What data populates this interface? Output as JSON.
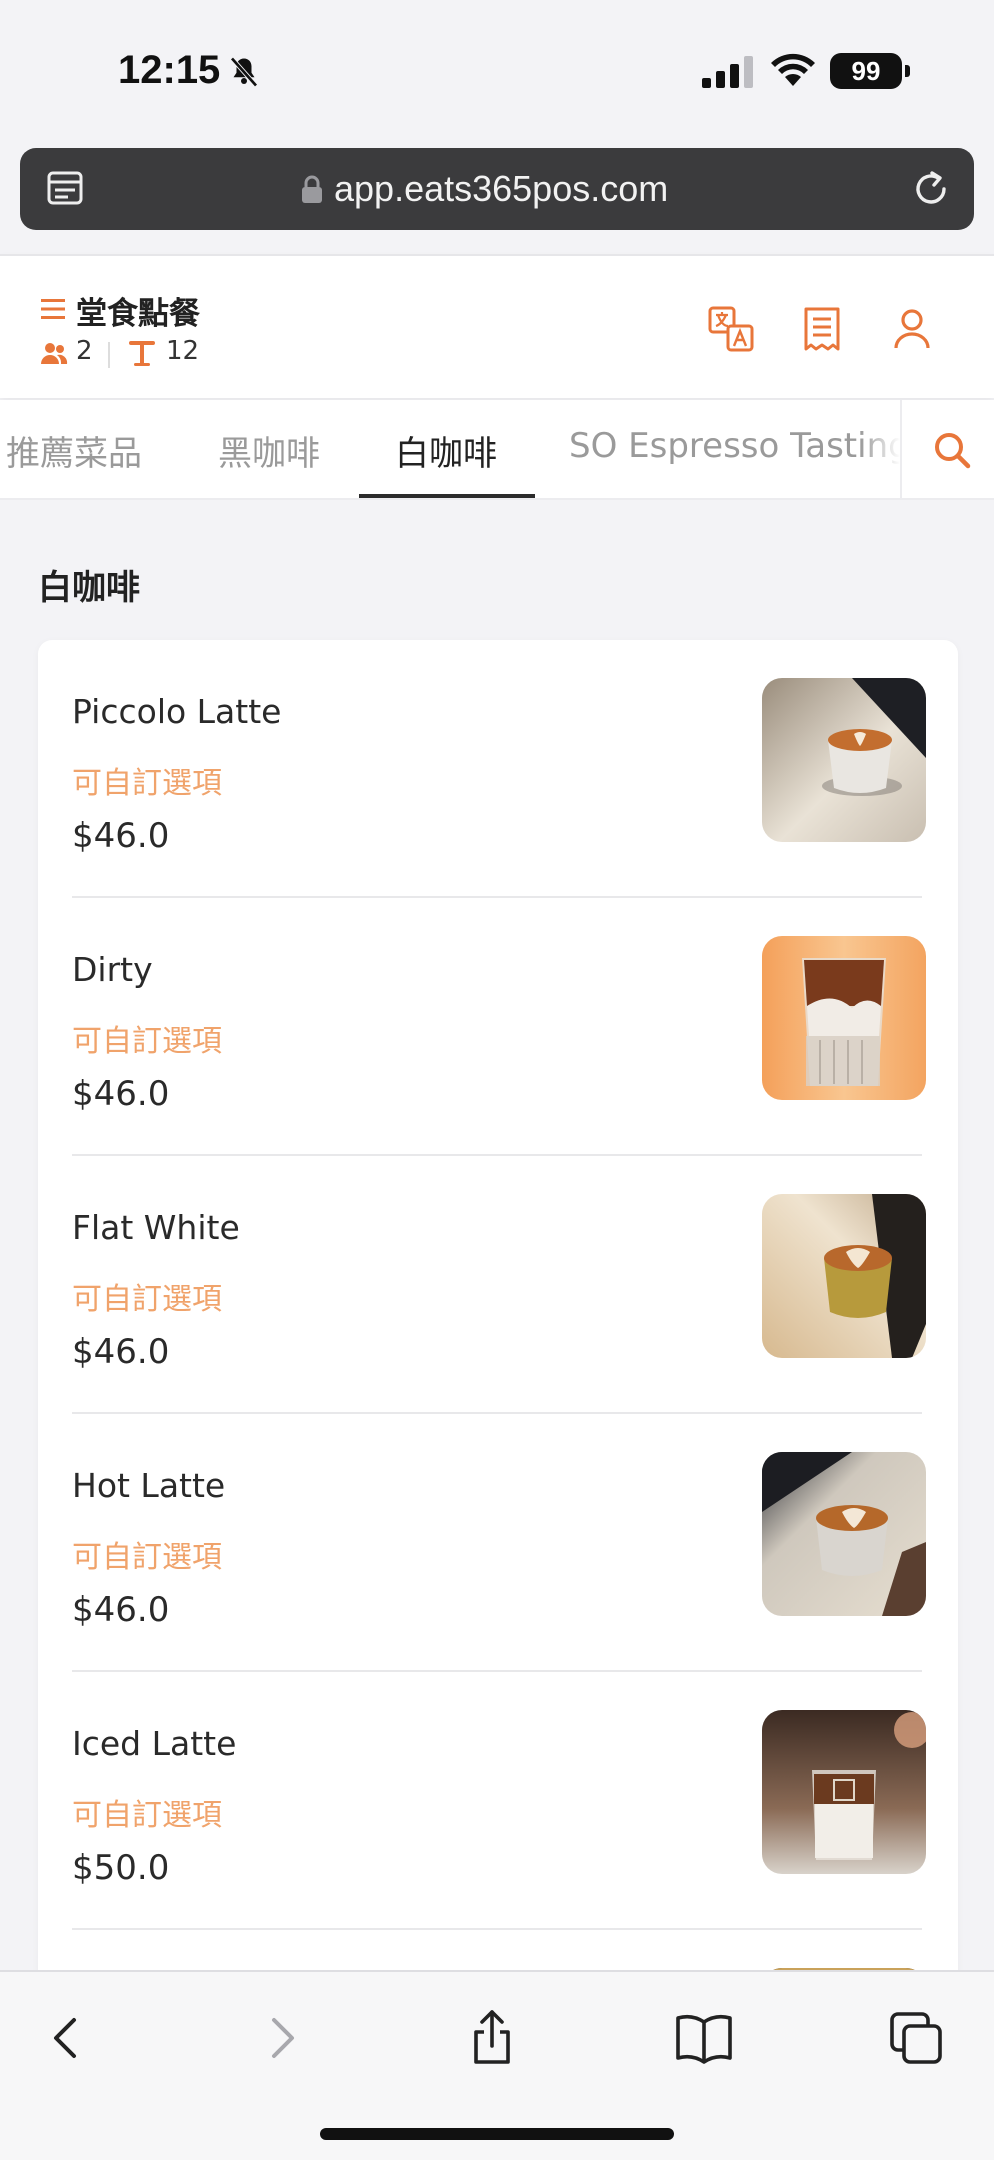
{
  "status_bar": {
    "time": "12:15",
    "battery": "99"
  },
  "browser": {
    "url": "app.eats365pos.com"
  },
  "header": {
    "title": "堂食點餐",
    "guests": "2",
    "table": "12"
  },
  "tabs": [
    {
      "label": "推薦菜品"
    },
    {
      "label": "黑咖啡"
    },
    {
      "label": "白咖啡"
    },
    {
      "label": "SO Espresso Tasting"
    }
  ],
  "active_tab": "白咖啡",
  "section": {
    "title": "白咖啡"
  },
  "items": [
    {
      "name": "Piccolo Latte",
      "option": "可自訂選項",
      "price": "$46.0"
    },
    {
      "name": "Dirty",
      "option": "可自訂選項",
      "price": "$46.0"
    },
    {
      "name": "Flat White",
      "option": "可自訂選項",
      "price": "$46.0"
    },
    {
      "name": "Hot Latte",
      "option": "可自訂選項",
      "price": "$46.0"
    },
    {
      "name": "Iced Latte",
      "option": "可自訂選項",
      "price": "$50.0"
    }
  ],
  "colors": {
    "accent": "#e8763a",
    "option_text": "#f0a36b"
  }
}
